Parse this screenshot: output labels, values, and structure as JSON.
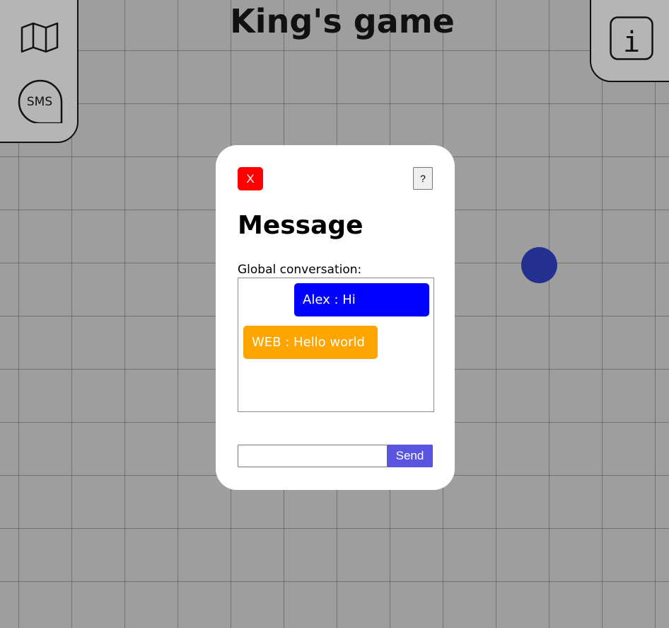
{
  "header": {
    "title": "King's game"
  },
  "left_panel": {
    "map_icon": "map-icon",
    "sms_icon": "sms-icon",
    "sms_label": "SMS"
  },
  "right_panel": {
    "info_icon": "info-icon",
    "info_glyph": "i"
  },
  "modal": {
    "close_label": "X",
    "help_label": "?",
    "title": "Message",
    "conversation_label": "Global conversation:",
    "messages": [
      {
        "text": "Alex : Hi",
        "color": "#0000ff"
      },
      {
        "text": "WEB : Hello world",
        "color": "#ffa500"
      }
    ],
    "input_value": "",
    "send_label": "Send"
  },
  "colors": {
    "background": "#9e9e9e",
    "panel": "#b5b5b5",
    "player_dot": "#23308f",
    "close_button": "#ff0000",
    "send_button": "#5a55e0"
  }
}
